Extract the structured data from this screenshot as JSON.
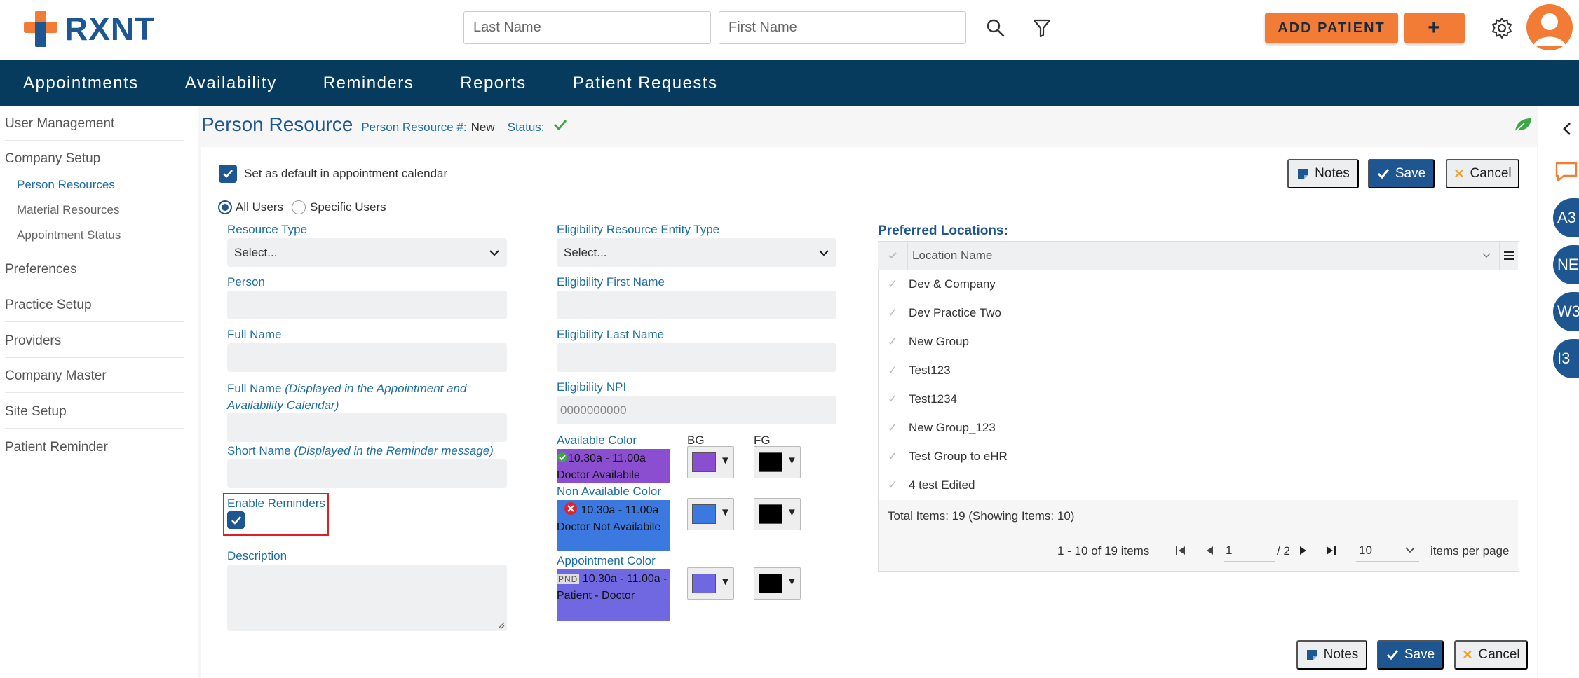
{
  "header": {
    "logo_text": "RXNT",
    "last_name_placeholder": "Last Name",
    "first_name_placeholder": "First Name",
    "add_patient_label": "ADD PATIENT",
    "add_plus_label": "+"
  },
  "nav": {
    "items": [
      "Appointments",
      "Availability",
      "Reminders",
      "Reports",
      "Patient Requests"
    ]
  },
  "sidebar": {
    "items": [
      "User Management",
      "Company Setup",
      "Preferences",
      "Practice Setup",
      "Providers",
      "Company Master",
      "Site Setup",
      "Patient Reminder"
    ],
    "sub_items": [
      "Person Resources",
      "Material Resources",
      "Appointment Status"
    ]
  },
  "page": {
    "title": "Person Resource",
    "resource_no_label": "Person Resource #:",
    "resource_no_value": "New",
    "status_label": "Status:"
  },
  "form": {
    "default_calendar_label": "Set as default in appointment calendar",
    "all_users_label": "All Users",
    "specific_users_label": "Specific Users",
    "resource_type_label": "Resource Type",
    "resource_type_value": "Select...",
    "person_label": "Person",
    "full_name_label": "Full Name",
    "full_name_disp_label": "Full Name",
    "full_name_disp_note": "(Displayed in the Appointment and Availability Calendar)",
    "short_name_label": "Short Name",
    "short_name_note": "(Displayed in the Reminder message)",
    "enable_reminders_label": "Enable Reminders",
    "description_label": "Description",
    "elig_entity_type_label": "Eligibility Resource Entity Type",
    "elig_entity_type_value": "Select...",
    "elig_first_name_label": "Eligibility First Name",
    "elig_last_name_label": "Eligibility Last Name",
    "elig_npi_label": "Eligibility NPI",
    "elig_npi_placeholder": "0000000000",
    "bg_label": "BG",
    "fg_label": "FG",
    "available_color_label": "Available Color",
    "available_sample": "10.30a - 11.00a Doctor Availabile",
    "available_bg": "#8c4ed1",
    "available_fg": "#000000",
    "non_available_color_label": "Non Available Color",
    "non_available_sample": "10.30a - 11.00a Doctor Not Availabile",
    "non_available_bg": "#3b78e0",
    "non_available_fg": "#000000",
    "appointment_color_label": "Appointment Color",
    "appointment_tag": "PND",
    "appointment_sample": "10.30a - 11.00a - Patient - Doctor",
    "appointment_bg": "#7068e0",
    "appointment_fg": "#000000"
  },
  "buttons": {
    "notes": "Notes",
    "save": "Save",
    "cancel": "Cancel"
  },
  "locations": {
    "title": "Preferred Locations:",
    "column_header": "Location Name",
    "rows": [
      "Dev & Company",
      "Dev Practice Two",
      "New Group",
      "Test123",
      "Test1234",
      "New Group_123",
      "Test Group to eHR",
      "4 test Edited"
    ],
    "total_text": "Total Items: 19 (Showing Items: 10)",
    "range_text": "1 - 10 of 19 items",
    "page_value": "1",
    "page_total": "/ 2",
    "per_page_value": "10",
    "per_page_label": "items per page"
  },
  "right_rail": {
    "avatars": [
      "A3",
      "NE",
      "W3",
      "I3"
    ]
  }
}
